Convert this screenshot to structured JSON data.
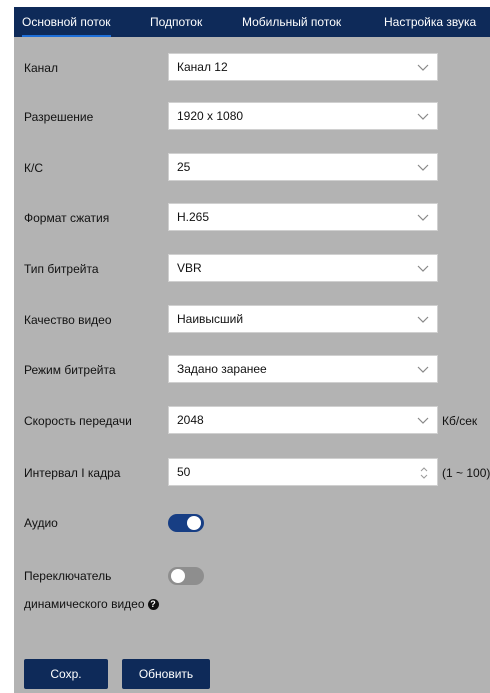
{
  "tabs": [
    {
      "label": "Основной поток",
      "active": true
    },
    {
      "label": "Подпоток",
      "active": false
    },
    {
      "label": "Мобильный поток",
      "active": false
    },
    {
      "label": "Настройка звука",
      "active": false
    }
  ],
  "form": {
    "channel": {
      "label": "Канал",
      "value": "Канал 12"
    },
    "resolution": {
      "label": "Разрешение",
      "value": "1920 x 1080"
    },
    "fps": {
      "label": "К/С",
      "value": "25"
    },
    "compression": {
      "label": "Формат сжатия",
      "value": "H.265"
    },
    "bitrate_type": {
      "label": "Тип битрейта",
      "value": "VBR"
    },
    "video_quality": {
      "label": "Качество видео",
      "value": "Наивысший"
    },
    "bitrate_mode": {
      "label": "Режим битрейта",
      "value": "Задано заранее"
    },
    "bitrate": {
      "label": "Скорость передачи",
      "value": "2048",
      "unit": "Кб/сек"
    },
    "iframe_interval": {
      "label": "Интервал I кадра",
      "value": "50",
      "range": "(1 ~ 100)"
    },
    "audio": {
      "label": "Аудио",
      "enabled": true
    },
    "dynamic_video": {
      "label_line1": "Переключатель",
      "label_line2": "динамического видео",
      "enabled": false
    }
  },
  "buttons": {
    "save": "Сохр.",
    "refresh": "Обновить"
  },
  "colors": {
    "header": "#0e2a59",
    "panel": "#b3b3b3",
    "toggle_on": "#173e84",
    "toggle_off": "#8e8e8e",
    "tab_active_underline": "#1e6fd9"
  }
}
